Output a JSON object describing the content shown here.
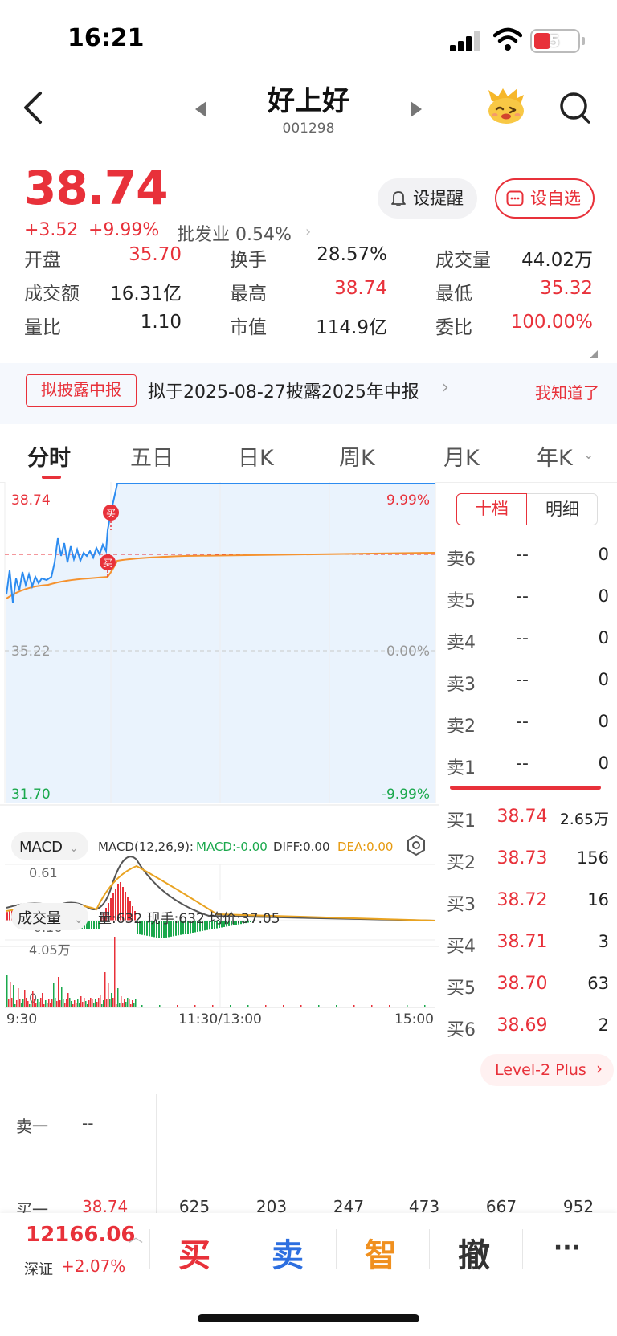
{
  "status_bar": {
    "time": "16:21",
    "battery": "5"
  },
  "nav": {
    "name": "好上好",
    "code": "001298"
  },
  "quote": {
    "price": "38.74",
    "change": "+3.52",
    "change_pct": "+9.99%",
    "industry": "批发业 0.54%",
    "remind_label": "设提醒",
    "watch_label": "设自选"
  },
  "stats": [
    {
      "label": "开盘",
      "value": "35.70",
      "color": "#e8313a"
    },
    {
      "label": "换手",
      "value": "28.57%",
      "color": "#222222"
    },
    {
      "label": "成交量",
      "value": "44.02万",
      "color": "#222222"
    },
    {
      "label": "成交额",
      "value": "16.31亿",
      "color": "#222222"
    },
    {
      "label": "最高",
      "value": "38.74",
      "color": "#e8313a"
    },
    {
      "label": "最低",
      "value": "35.32",
      "color": "#e8313a"
    },
    {
      "label": "量比",
      "value": "1.10",
      "color": "#222222"
    },
    {
      "label": "市值",
      "value": "114.9亿",
      "color": "#222222"
    },
    {
      "label": "委比",
      "value": "100.00%",
      "color": "#e8313a"
    }
  ],
  "banner": {
    "tag": "拟披露中报",
    "text": "拟于2025-08-27披露2025年中报",
    "dismiss": "我知道了"
  },
  "tabs": [
    "分时",
    "五日",
    "日K",
    "周K",
    "月K",
    "年K"
  ],
  "chart": {
    "price_high": "38.74",
    "price_prev": "35.22",
    "price_low": "31.70",
    "pct_high": "9.99%",
    "pct_zero": "0.00%",
    "pct_low": "-9.99%",
    "trade_marker": "买",
    "macd_selector": "MACD",
    "macd_params": "MACD(12,26,9):",
    "macd_value": "MACD:-0.00",
    "diff_value": "DIFF:0.00",
    "dea_value": "DEA:0.00",
    "macd_top": "0.61",
    "macd_bottom": "-0.16",
    "volume_selector": "成交量",
    "volume_info": "量:632 现手:632 均价:37.05",
    "volume_top": "4.05万",
    "volume_zero": "0",
    "time_start": "9:30",
    "time_mid": "11:30/13:00",
    "time_end": "15:00"
  },
  "order_book": {
    "toggle_left": "十档",
    "toggle_right": "明细",
    "asks": [
      {
        "label": "卖6",
        "price": "--",
        "vol": "0"
      },
      {
        "label": "卖5",
        "price": "--",
        "vol": "0"
      },
      {
        "label": "卖4",
        "price": "--",
        "vol": "0"
      },
      {
        "label": "卖3",
        "price": "--",
        "vol": "0"
      },
      {
        "label": "卖2",
        "price": "--",
        "vol": "0"
      },
      {
        "label": "卖1",
        "price": "--",
        "vol": "0"
      }
    ],
    "bids": [
      {
        "label": "买1",
        "price": "38.74",
        "vol": "2.65万"
      },
      {
        "label": "买2",
        "price": "38.73",
        "vol": "156"
      },
      {
        "label": "买3",
        "price": "38.72",
        "vol": "16"
      },
      {
        "label": "买4",
        "price": "38.71",
        "vol": "3"
      },
      {
        "label": "买5",
        "price": "38.70",
        "vol": "63"
      },
      {
        "label": "买6",
        "price": "38.69",
        "vol": "2"
      }
    ],
    "level2": "Level-2 Plus"
  },
  "bottom_orders": {
    "sell1_label": "卖一",
    "sell1_value": "--",
    "buy1_label": "买一",
    "buy1_value": "38.74",
    "queue": [
      "625",
      "203",
      "247",
      "473",
      "667",
      "952"
    ]
  },
  "bottom_bar": {
    "index_value": "12166.06",
    "index_name": "深证",
    "index_pct": "+2.07%",
    "buy": "买",
    "sell": "卖",
    "smart": "智",
    "cancel": "撤",
    "more": "···"
  },
  "colors": {
    "up": "#e8313a",
    "down": "#1aa84c",
    "price_line": "#2d8cf0",
    "avg_line": "#f5922f"
  }
}
